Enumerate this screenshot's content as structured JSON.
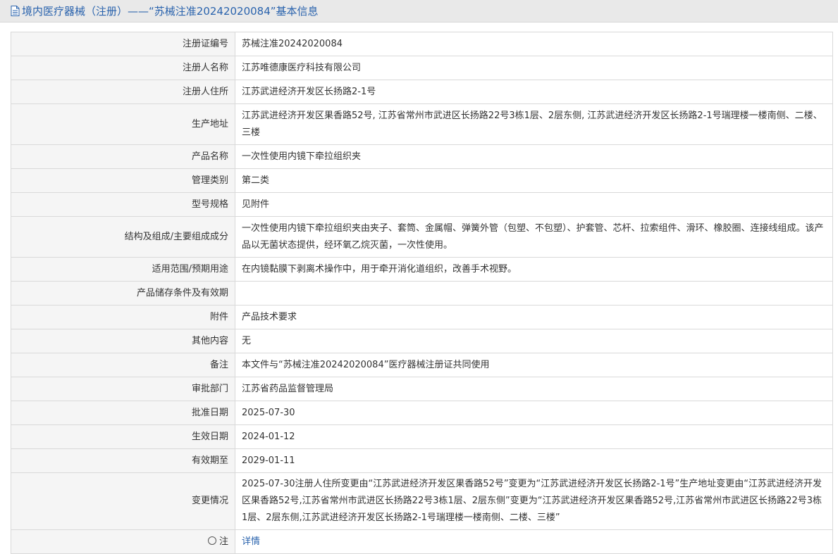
{
  "header": {
    "title": "境内医疗器械（注册）——“苏械注准20242020084”基本信息"
  },
  "rows": [
    {
      "label": "注册证编号",
      "value": "苏械注准20242020084"
    },
    {
      "label": "注册人名称",
      "value": "江苏唯德康医疗科技有限公司"
    },
    {
      "label": "注册人住所",
      "value": "江苏武进经济开发区长扬路2-1号"
    },
    {
      "label": "生产地址",
      "value": "江苏武进经济开发区果香路52号, 江苏省常州市武进区长扬路22号3栋1层、2层东侧, 江苏武进经济开发区长扬路2-1号瑞理楼一楼南侧、二楼、三楼"
    },
    {
      "label": "产品名称",
      "value": "一次性使用内镜下牵拉组织夹"
    },
    {
      "label": "管理类别",
      "value": "第二类"
    },
    {
      "label": "型号规格",
      "value": "见附件"
    },
    {
      "label": "结构及组成/主要组成成分",
      "value": "一次性使用内镜下牵拉组织夹由夹子、套筒、金属帽、弹簧外管（包塑、不包塑）、护套管、芯杆、拉索组件、滑环、橡胶圈、连接线组成。该产品以无菌状态提供，经环氧乙烷灭菌，一次性使用。"
    },
    {
      "label": "适用范围/预期用途",
      "value": "在内镜黏膜下剥离术操作中，用于牵开消化道组织，改善手术视野。"
    },
    {
      "label": "产品储存条件及有效期",
      "value": ""
    },
    {
      "label": "附件",
      "value": "产品技术要求"
    },
    {
      "label": "其他内容",
      "value": "无"
    },
    {
      "label": "备注",
      "value": "本文件与“苏械注准20242020084”医疗器械注册证共同使用"
    },
    {
      "label": "审批部门",
      "value": "江苏省药品监督管理局"
    },
    {
      "label": "批准日期",
      "value": "2025-07-30"
    },
    {
      "label": "生效日期",
      "value": "2024-01-12"
    },
    {
      "label": "有效期至",
      "value": "2029-01-11"
    },
    {
      "label": "变更情况",
      "value": "2025-07-30注册人住所变更由“江苏武进经济开发区果香路52号”变更为“江苏武进经济开发区长扬路2-1号”生产地址变更由“江苏武进经济开发区果香路52号,江苏省常州市武进区长扬路22号3栋1层、2层东侧”变更为“江苏武进经济开发区果香路52号,江苏省常州市武进区长扬路22号3栋1层、2层东侧,江苏武进经济开发区长扬路2-1号瑞理楼一楼南侧、二楼、三楼”"
    }
  ],
  "footer_row": {
    "label": "注",
    "value": "详情"
  }
}
